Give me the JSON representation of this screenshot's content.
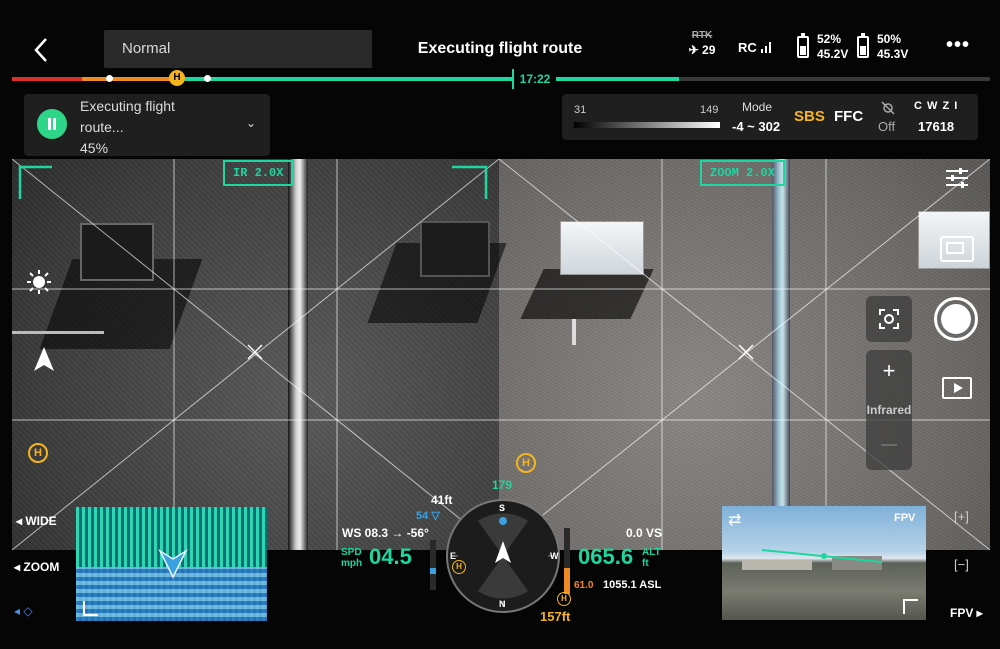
{
  "header": {
    "mode": "Normal",
    "title": "Executing flight route",
    "rtk_label": "RTK",
    "satellites": "29",
    "rc_label": "RC",
    "battery1_pct": "52%",
    "battery1_volt": "45.2V",
    "battery2_pct": "50%",
    "battery2_volt": "45.3V",
    "more_icon": "more-icon"
  },
  "progress": {
    "time": "17:22",
    "fraction": 0.45,
    "home_marker": "H"
  },
  "mission": {
    "line1": "Executing flight",
    "line2": "route...",
    "percent": "45%"
  },
  "thermal": {
    "min": "31",
    "max": "149",
    "mode_label": "Mode",
    "mode_value": "-4 ~ 302",
    "sbs": "SBS",
    "ffc": "FFC",
    "off": "Off",
    "storage_label": "C W Z I",
    "storage_value": "17618"
  },
  "video": {
    "ir_zoom": "IR 2.0X",
    "vis_zoom": "ZOOM 2.0X",
    "home_marker": "H",
    "wide_label": "WIDE"
  },
  "right_panel": {
    "infrared": "Infrared",
    "plus": "+",
    "minus": "—"
  },
  "left_side": {
    "zoom": "ZOOM"
  },
  "flight": {
    "alt_top": "41ft",
    "alt_top_green": "179",
    "height_small": "54",
    "ws": "WS 08.3 → -56°",
    "spd_label": "SPD",
    "spd_unit": "mph",
    "speed": "04.5",
    "alt_label": "ALT",
    "alt_unit": "ft",
    "altitude": "065.6",
    "vs": "0.0 VS",
    "home_dist": "61.0",
    "asl": "1055.1 ASL",
    "bottom_alt": "157ft",
    "compass": {
      "n": "N",
      "e": "E",
      "s": "S",
      "w": "W"
    }
  },
  "pip": {
    "label": "FPV",
    "swap_icon": "swap-icon"
  },
  "bottom_right": {
    "fpv": "FPV",
    "plus_bracket": "[+]",
    "minus_bracket": "[−]"
  },
  "colors": {
    "accent_green": "#1ed6a0",
    "play_green": "#2ed689",
    "warning_yellow": "#f5b51c",
    "route_red": "#d9302c",
    "route_orange": "#f08a24"
  }
}
